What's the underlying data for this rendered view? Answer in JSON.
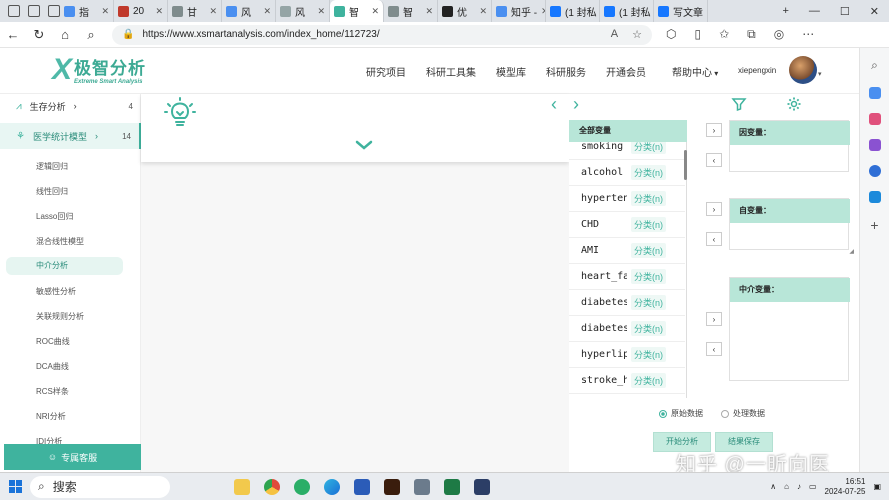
{
  "browser": {
    "tabs": [
      {
        "label": "指",
        "active": false
      },
      {
        "label": "20",
        "active": false
      },
      {
        "label": "甘",
        "active": false
      },
      {
        "label": "风",
        "active": false
      },
      {
        "label": "风",
        "active": false
      },
      {
        "label": "智",
        "active": true
      },
      {
        "label": "智",
        "active": false
      },
      {
        "label": "优",
        "active": false
      },
      {
        "label": "知乎 -",
        "active": false
      },
      {
        "label": "(1 封私",
        "active": false
      },
      {
        "label": "(1 封私",
        "active": false
      },
      {
        "label": "写文章",
        "active": false
      }
    ],
    "url": "https://www.xsmartanalysis.com/index_home/112723/"
  },
  "site": {
    "logo_cn": "极智分析",
    "logo_en": "Extreme Smart Analysis",
    "nav": [
      "研究项目",
      "科研工具集",
      "模型库",
      "科研服务",
      "开通会员"
    ],
    "help": "帮助中心",
    "username": "xiepengxin"
  },
  "sidebar": {
    "categories": [
      {
        "label": "生存分析",
        "count": "4"
      },
      {
        "label": "医学统计模型",
        "count": "14"
      }
    ],
    "sub_items": [
      "逻辑回归",
      "线性回归",
      "Lasso回归",
      "混合线性模型",
      "中介分析",
      "敏感性分析",
      "关联规则分析",
      "ROC曲线",
      "DCA曲线",
      "RCS样条",
      "NRI分析",
      "IDI分析"
    ],
    "service": "专属客服"
  },
  "variables": {
    "header": "全部变量",
    "items": [
      {
        "name": "smoking",
        "type": "分类(n)"
      },
      {
        "name": "alcohol",
        "type": "分类(n)"
      },
      {
        "name": "hypertension",
        "type": "分类(n)"
      },
      {
        "name": "CHD",
        "type": "分类(n)"
      },
      {
        "name": "AMI",
        "type": "分类(n)"
      },
      {
        "name": "heart_failure",
        "type": "分类(n)"
      },
      {
        "name": "diabetes",
        "type": "分类(n)"
      },
      {
        "name": "diabetes",
        "type": "分类(n)"
      },
      {
        "name": "hyperlipidemia",
        "type": "分类(n)"
      },
      {
        "name": "stroke_h",
        "type": "分类(n)"
      }
    ],
    "dependent": "因变量：",
    "independent": "自变量：",
    "mediator": "中介变量：",
    "radio_raw": "原始数据",
    "radio_processed": "处理数据",
    "start_btn": "开始分析",
    "save_btn": "结果保存"
  },
  "taskbar": {
    "search": "搜索",
    "time": "16:51",
    "date": "2024-07-25"
  },
  "watermark": "知乎 @一昕向医",
  "colors": {
    "accent": "#3fb39e",
    "header_green": "#b8e6d8"
  }
}
